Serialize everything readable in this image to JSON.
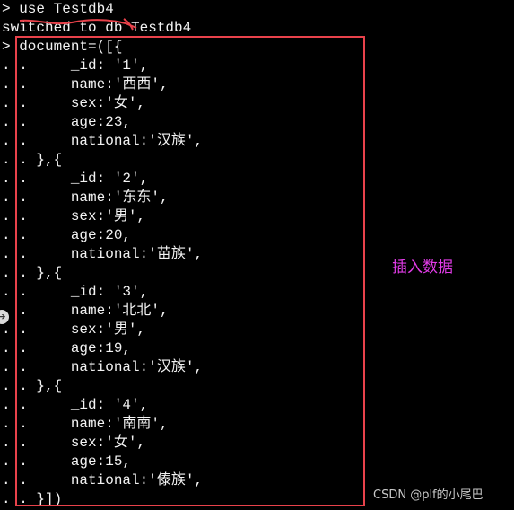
{
  "terminal": {
    "lines": [
      "> use Testdb4",
      "switched to db Testdb4",
      "> document=([{",
      ". .     _id: '1',",
      ". .     name:'西西',",
      ". .     sex:'女',",
      ". .     age:23,",
      ". .     national:'汉族',",
      ". . },{",
      ". .     _id: '2',",
      ". .     name:'东东',",
      ". .     sex:'男',",
      ". .     age:20,",
      ". .     national:'苗族',",
      ". . },{",
      ". .     _id: '3',",
      ". .     name:'北北',",
      ". .     sex:'男',",
      ". .     age:19,",
      ". .     national:'汉族',",
      ". . },{",
      ". .     _id: '4',",
      ". .     name:'南南',",
      ". .     sex:'女',",
      ". .     age:15,",
      ". .     national:'傣族',",
      ". . }])"
    ]
  },
  "annotation": {
    "text": "插入数据",
    "color": "#e23ce8"
  },
  "watermark": {
    "text": "CSDN @plf的小尾巴"
  },
  "highlight": {
    "color": "#e8424b"
  },
  "side_handle": {
    "icon": "arrow-icon",
    "glyph": "➔"
  }
}
